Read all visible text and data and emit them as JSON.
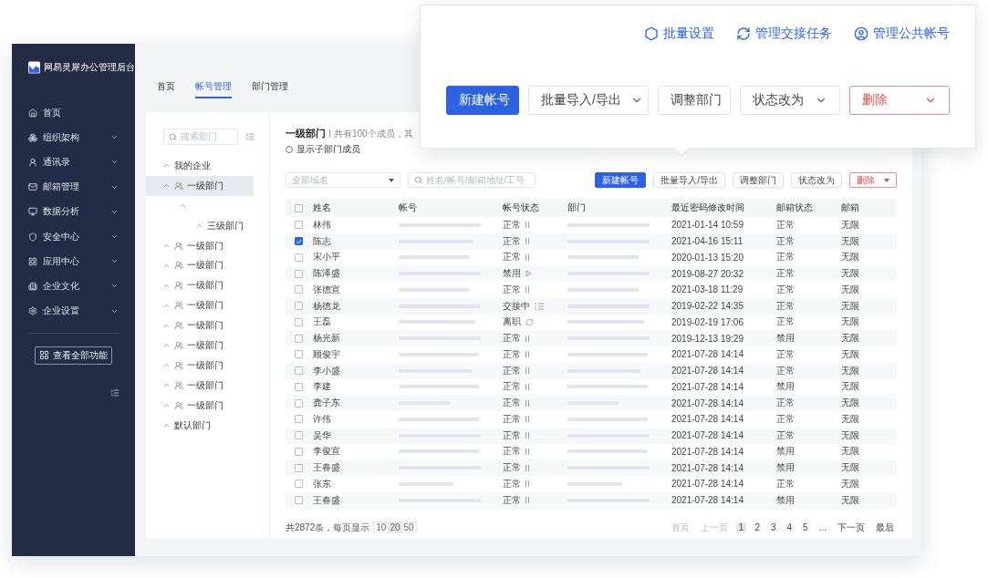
{
  "sidebar": {
    "logo_text": "网易灵犀办公管理后台",
    "items": [
      {
        "label": "首页",
        "has_submenu": false
      },
      {
        "label": "组织架构",
        "has_submenu": true
      },
      {
        "label": "通讯录",
        "has_submenu": true
      },
      {
        "label": "邮箱管理",
        "has_submenu": true
      },
      {
        "label": "数据分析",
        "has_submenu": true
      },
      {
        "label": "安全中心",
        "has_submenu": true
      },
      {
        "label": "应用中心",
        "has_submenu": true
      },
      {
        "label": "企业文化",
        "has_submenu": true
      },
      {
        "label": "企业设置",
        "has_submenu": true
      }
    ],
    "all_features_button": "查看全部功能"
  },
  "tabs": [
    {
      "label": "首页",
      "selected": false
    },
    {
      "label": "帐号管理",
      "selected": true
    },
    {
      "label": "部门管理",
      "selected": false
    }
  ],
  "tree": {
    "search": {
      "placeholder": "搜索部门"
    },
    "items": [
      {
        "label": "我的企业",
        "kind": "plain",
        "selected": false
      },
      {
        "label": "一级部门",
        "kind": "department",
        "selected": true,
        "children": [
          {
            "selected": false,
            "children": [
              {
                "label": "三级部门",
                "selected": false
              }
            ]
          }
        ]
      },
      {
        "label": "一级部门",
        "kind": "department",
        "selected": false
      },
      {
        "label": "一级部门",
        "kind": "department",
        "selected": false
      },
      {
        "label": "一级部门",
        "kind": "department",
        "selected": false
      },
      {
        "label": "一级部门",
        "kind": "department",
        "selected": false
      },
      {
        "label": "一级部门",
        "kind": "department",
        "selected": false
      },
      {
        "label": "一级部门",
        "kind": "department",
        "selected": false
      },
      {
        "label": "一级部门",
        "kind": "department",
        "selected": false
      },
      {
        "label": "一级部门",
        "kind": "department",
        "selected": false
      },
      {
        "label": "一级部门",
        "kind": "department",
        "selected": false
      },
      {
        "label": "默认部门",
        "kind": "plain",
        "selected": false
      }
    ]
  },
  "content": {
    "title": "一级部门",
    "summary": "共有100个成员，其",
    "show_sub_members": {
      "label": "显示子部门成员",
      "checked": false
    },
    "domain_select": {
      "value": "全部域名"
    },
    "search": {
      "placeholder": "姓名/帐号/邮箱地址/工号"
    },
    "toolbar": [
      {
        "label": "新建帐号",
        "kind": "primary",
        "dropdown": false
      },
      {
        "label": "批量导入/导出",
        "kind": "default",
        "dropdown": false
      },
      {
        "label": "调整部门",
        "kind": "default",
        "dropdown": false
      },
      {
        "label": "状态改为",
        "kind": "default",
        "dropdown": false
      },
      {
        "label": "删除",
        "kind": "danger",
        "dropdown": true
      }
    ]
  },
  "table": {
    "select_all_checked": false,
    "columns": [
      "姓名",
      "帐号",
      "帐号状态",
      "部门",
      "最近密码修改时间",
      "邮箱状态",
      "邮箱"
    ],
    "rows": [
      {
        "checked": false,
        "name": "林伟",
        "status": "正常",
        "kind": "active",
        "time": "2021-01-14 10:59",
        "mail_status": "正常",
        "mailbox": "无限"
      },
      {
        "checked": true,
        "name": "陈志",
        "status": "正常",
        "kind": "active",
        "time": "2021-04-16 15:11",
        "mail_status": "正常",
        "mailbox": "无限"
      },
      {
        "checked": false,
        "name": "宋小平",
        "status": "正常",
        "kind": "active",
        "time": "2020-01-13 15:20",
        "mail_status": "正常",
        "mailbox": "无限"
      },
      {
        "checked": false,
        "name": "陈泽盛",
        "status": "禁用",
        "kind": "disabled",
        "time": "2019-08-27 20:32",
        "mail_status": "正常",
        "mailbox": "无限"
      },
      {
        "checked": false,
        "name": "张德宣",
        "status": "正常",
        "kind": "active",
        "time": "2021-03-18 11:29",
        "mail_status": "正常",
        "mailbox": "无限"
      },
      {
        "checked": false,
        "name": "杨德龙",
        "status": "交接中",
        "kind": "handover",
        "time": "2019-02-22 14:35",
        "mail_status": "正常",
        "mailbox": "无限"
      },
      {
        "checked": false,
        "name": "王磊",
        "status": "离职",
        "kind": "resigned",
        "time": "2019-02-19 17:06",
        "mail_status": "正常",
        "mailbox": "无限"
      },
      {
        "checked": false,
        "name": "杨光新",
        "status": "正常",
        "kind": "active",
        "time": "2019-12-13 19:29",
        "mail_status": "禁用",
        "mailbox": "无限"
      },
      {
        "checked": false,
        "name": "顾俊宇",
        "status": "正常",
        "kind": "active",
        "time": "2021-07-28 14:14",
        "mail_status": "正常",
        "mailbox": "无限"
      },
      {
        "checked": false,
        "name": "李小盛",
        "status": "正常",
        "kind": "active",
        "time": "2021-07-28 14:14",
        "mail_status": "正常",
        "mailbox": "无限"
      },
      {
        "checked": false,
        "name": "李建",
        "status": "正常",
        "kind": "active",
        "time": "2021-07-28 14:14",
        "mail_status": "禁用",
        "mailbox": "无限"
      },
      {
        "checked": false,
        "name": "龚子东",
        "status": "正常",
        "kind": "active",
        "time": "2021-07-28 14:14",
        "mail_status": "正常",
        "mailbox": "无限"
      },
      {
        "checked": false,
        "name": "许伟",
        "status": "正常",
        "kind": "active",
        "time": "2021-07-28 14:14",
        "mail_status": "正常",
        "mailbox": "无限"
      },
      {
        "checked": false,
        "name": "吴华",
        "status": "正常",
        "kind": "active",
        "time": "2021-07-28 14:14",
        "mail_status": "正常",
        "mailbox": "无限"
      },
      {
        "checked": false,
        "name": "李俊宣",
        "status": "正常",
        "kind": "active",
        "time": "2021-07-28 14:14",
        "mail_status": "禁用",
        "mailbox": "无限"
      },
      {
        "checked": false,
        "name": "王春盛",
        "status": "正常",
        "kind": "active",
        "time": "2021-07-28 14:14",
        "mail_status": "禁用",
        "mailbox": "无限"
      },
      {
        "checked": false,
        "name": "张东",
        "status": "正常",
        "kind": "active",
        "time": "2021-07-28 14:14",
        "mail_status": "正常",
        "mailbox": "无限"
      },
      {
        "checked": false,
        "name": "王春盛",
        "status": "正常",
        "kind": "active",
        "time": "2021-07-28 14:14",
        "mail_status": "禁用",
        "mailbox": "无限"
      }
    ]
  },
  "pagination": {
    "summary": "共2872条，每页显示",
    "page_sizes": [
      {
        "label": "10",
        "selected": false
      },
      {
        "label": "20",
        "selected": true
      },
      {
        "label": "50",
        "selected": false
      }
    ],
    "pages": [
      {
        "label": "首页",
        "disabled": true,
        "selected": false
      },
      {
        "label": "上一页",
        "disabled": true,
        "selected": false
      },
      {
        "label": "1",
        "disabled": false,
        "selected": true
      },
      {
        "label": "2",
        "disabled": false,
        "selected": false
      },
      {
        "label": "3",
        "disabled": false,
        "selected": false
      },
      {
        "label": "4",
        "disabled": false,
        "selected": false
      },
      {
        "label": "5",
        "disabled": false,
        "selected": false
      },
      {
        "label": "...",
        "disabled": false,
        "selected": false
      },
      {
        "label": "下一页",
        "disabled": false,
        "selected": false
      },
      {
        "label": "最后",
        "disabled": false,
        "selected": false
      }
    ]
  },
  "popup": {
    "links": [
      {
        "label": "批量设置"
      },
      {
        "label": "管理交接任务"
      },
      {
        "label": "管理公共帐号"
      }
    ],
    "buttons": [
      {
        "label": "新建帐号",
        "kind": "primary",
        "dropdown": false
      },
      {
        "label": "批量导入/导出",
        "kind": "default",
        "dropdown": true
      },
      {
        "label": "调整部门",
        "kind": "default",
        "dropdown": false
      },
      {
        "label": "状态改为",
        "kind": "default",
        "dropdown": true
      },
      {
        "label": "删除",
        "kind": "danger",
        "dropdown": true
      }
    ]
  }
}
